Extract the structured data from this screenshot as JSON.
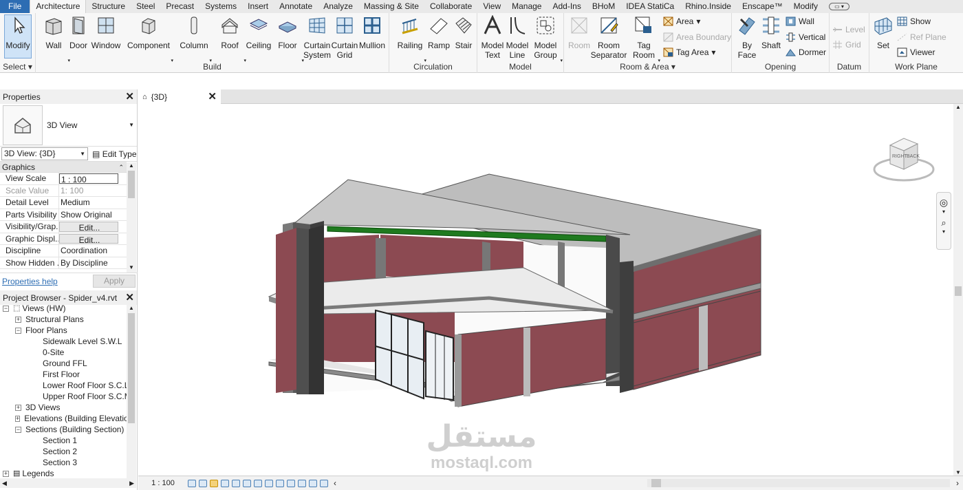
{
  "tabs": [
    "File",
    "Architecture",
    "Structure",
    "Steel",
    "Precast",
    "Systems",
    "Insert",
    "Annotate",
    "Analyze",
    "Massing & Site",
    "Collaborate",
    "View",
    "Manage",
    "Add-Ins",
    "BHoM",
    "IDEA StatiCa",
    "Rhino.Inside",
    "Enscape™",
    "Modify"
  ],
  "active_tab": "Architecture",
  "ribbon": {
    "select": {
      "modify": "Modify",
      "label": "Select"
    },
    "build": {
      "label": "Build",
      "wall": "Wall",
      "door": "Door",
      "window": "Window",
      "component": "Component",
      "column": "Column",
      "roof": "Roof",
      "ceiling": "Ceiling",
      "floor": "Floor",
      "curtain_system": "Curtain System",
      "curtain_grid": "Curtain Grid",
      "mullion": "Mullion"
    },
    "circulation": {
      "label": "Circulation",
      "railing": "Railing",
      "ramp": "Ramp",
      "stair": "Stair"
    },
    "model": {
      "label": "Model",
      "model_text": "Model Text",
      "model_line": "Model Line",
      "model_group": "Model Group"
    },
    "room_area": {
      "label": "Room & Area",
      "room": "Room",
      "room_separator": "Room Separator",
      "tag_room": "Tag Room",
      "area": "Area",
      "area_boundary": "Area Boundary",
      "tag_area": "Tag Area"
    },
    "opening": {
      "label": "Opening",
      "by_face": "By Face",
      "shaft": "Shaft",
      "wall": "Wall",
      "vertical": "Vertical",
      "dormer": "Dormer"
    },
    "datum": {
      "label": "Datum",
      "level": "Level",
      "grid": "Grid"
    },
    "work_plane": {
      "label": "Work Plane",
      "set": "Set",
      "show": "Show",
      "ref_plane": "Ref Plane",
      "viewer": "Viewer"
    }
  },
  "properties": {
    "title": "Properties",
    "type_name": "3D View",
    "view_selector": "3D View: {3D}",
    "edit_type": "Edit Type",
    "group": "Graphics",
    "rows": [
      {
        "k": "View Scale",
        "v": "1 : 100"
      },
      {
        "k": "Scale Value",
        "v": "1:  100"
      },
      {
        "k": "Detail Level",
        "v": "Medium"
      },
      {
        "k": "Parts Visibility",
        "v": "Show Original"
      },
      {
        "k": "Visibility/Grap...",
        "v": "Edit..."
      },
      {
        "k": "Graphic Displ...",
        "v": "Edit..."
      },
      {
        "k": "Discipline",
        "v": "Coordination"
      },
      {
        "k": "Show Hidden ...",
        "v": "By Discipline"
      }
    ],
    "help": "Properties help",
    "apply": "Apply"
  },
  "browser": {
    "title": "Project Browser - Spider_v4.rvt",
    "items": [
      "Views (HW)",
      "Structural Plans",
      "Floor Plans",
      "Sidewalk Level S.W.L",
      "0-Site",
      "Ground FFL",
      "First Floor",
      "Lower Roof Floor S.C.L",
      "Upper Roof Floor S.C.M",
      "3D Views",
      "Elevations (Building Elevatio",
      "Sections (Building Section)",
      "Section 1",
      "Section 2",
      "Section 3",
      "Legends"
    ]
  },
  "view": {
    "tab": "{3D}",
    "scale": "1 : 100",
    "cube_faces": [
      "RIGHT",
      "BACK"
    ]
  },
  "watermark": {
    "arabic": "مستقل",
    "latin": "mostaql.com"
  },
  "colors": {
    "file_tab": "#2d6db3",
    "wall": "#8c4a52",
    "accent": "#2d6db3",
    "green_beam": "#1f7a1f"
  }
}
